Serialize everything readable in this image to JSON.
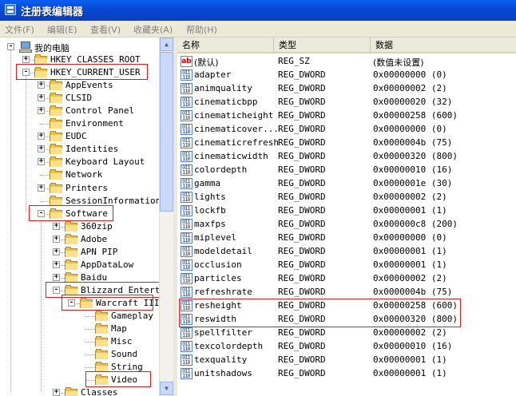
{
  "window": {
    "title": "注册表编辑器"
  },
  "menu": [
    "文件(F)",
    "编辑(E)",
    "查看(V)",
    "收藏夹(A)",
    "帮助(H)"
  ],
  "tree": {
    "root": "我的电脑",
    "hkcr": "HKEY_CLASSES_ROOT",
    "hkcu": "HKEY_CURRENT_USER",
    "hkcu_children": [
      "AppEvents",
      "CLSID",
      "Control Panel",
      "Environment",
      "EUDC",
      "Identities",
      "Keyboard Layout",
      "Network",
      "Printers",
      "SessionInformation",
      "Software"
    ],
    "software_children": [
      "360zip",
      "Adobe",
      "APN PIP",
      "AppDataLow",
      "Baidu",
      "Blizzard Enterta"
    ],
    "blizzard_child": "Warcraft III",
    "warcraft_children": [
      "Gameplay",
      "Map",
      "Misc",
      "Sound",
      "String",
      "Video"
    ],
    "after": "Classes"
  },
  "columns": {
    "name": "名称",
    "type": "类型",
    "data": "数据"
  },
  "values": [
    {
      "name": "(默认)",
      "type": "REG_SZ",
      "data": "(数值未设置)",
      "icon": "string"
    },
    {
      "name": "adapter",
      "type": "REG_DWORD",
      "data": "0x00000000 (0)",
      "icon": "binary"
    },
    {
      "name": "animquality",
      "type": "REG_DWORD",
      "data": "0x00000002 (2)",
      "icon": "binary"
    },
    {
      "name": "cinematicbpp",
      "type": "REG_DWORD",
      "data": "0x00000020 (32)",
      "icon": "binary"
    },
    {
      "name": "cinematicheight",
      "type": "REG_DWORD",
      "data": "0x00000258 (600)",
      "icon": "binary"
    },
    {
      "name": "cinematicover...",
      "type": "REG_DWORD",
      "data": "0x00000000 (0)",
      "icon": "binary"
    },
    {
      "name": "cinematicrefresh",
      "type": "REG_DWORD",
      "data": "0x0000004b (75)",
      "icon": "binary"
    },
    {
      "name": "cinematicwidth",
      "type": "REG_DWORD",
      "data": "0x00000320 (800)",
      "icon": "binary"
    },
    {
      "name": "colordepth",
      "type": "REG_DWORD",
      "data": "0x00000010 (16)",
      "icon": "binary"
    },
    {
      "name": "gamma",
      "type": "REG_DWORD",
      "data": "0x0000001e (30)",
      "icon": "binary"
    },
    {
      "name": "lights",
      "type": "REG_DWORD",
      "data": "0x00000002 (2)",
      "icon": "binary"
    },
    {
      "name": "lockfb",
      "type": "REG_DWORD",
      "data": "0x00000001 (1)",
      "icon": "binary"
    },
    {
      "name": "maxfps",
      "type": "REG_DWORD",
      "data": "0x000000c8 (200)",
      "icon": "binary"
    },
    {
      "name": "miplevel",
      "type": "REG_DWORD",
      "data": "0x00000000 (0)",
      "icon": "binary"
    },
    {
      "name": "modeldetail",
      "type": "REG_DWORD",
      "data": "0x00000001 (1)",
      "icon": "binary"
    },
    {
      "name": "occlusion",
      "type": "REG_DWORD",
      "data": "0x00000001 (1)",
      "icon": "binary"
    },
    {
      "name": "particles",
      "type": "REG_DWORD",
      "data": "0x00000002 (2)",
      "icon": "binary"
    },
    {
      "name": "refreshrate",
      "type": "REG_DWORD",
      "data": "0x0000004b (75)",
      "icon": "binary"
    },
    {
      "name": "resheight",
      "type": "REG_DWORD",
      "data": "0x00000258 (600)",
      "icon": "binary"
    },
    {
      "name": "reswidth",
      "type": "REG_DWORD",
      "data": "0x00000320 (800)",
      "icon": "binary"
    },
    {
      "name": "spellfilter",
      "type": "REG_DWORD",
      "data": "0x00000002 (2)",
      "icon": "binary"
    },
    {
      "name": "texcolordepth",
      "type": "REG_DWORD",
      "data": "0x00000010 (16)",
      "icon": "binary"
    },
    {
      "name": "texquality",
      "type": "REG_DWORD",
      "data": "0x00000001 (1)",
      "icon": "binary"
    },
    {
      "name": "unitshadows",
      "type": "REG_DWORD",
      "data": "0x00000001 (1)",
      "icon": "binary"
    }
  ],
  "highlight_color": "#e31b1b"
}
